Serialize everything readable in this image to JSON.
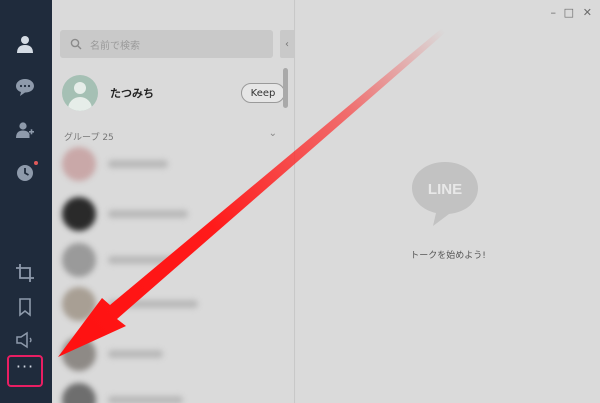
{
  "sidebar": {
    "icons": [
      "profile-icon",
      "chat-icon",
      "add-friend-icon",
      "timeline-icon",
      "crop-icon",
      "bookmark-icon",
      "announcement-icon",
      "more-icon"
    ],
    "more_label": "···"
  },
  "friends": {
    "search_placeholder": "名前で検索",
    "profile_name": "たつみち",
    "keep_label": "Keep",
    "group_header": "グループ 25"
  },
  "chat": {
    "logo_text": "LINE",
    "empty_message": "トークを始めよう!",
    "window_controls": [
      "–",
      "□",
      "✕"
    ]
  },
  "colors": {
    "sidebar_bg": "#1f2b3c",
    "panel_bg": "#dadada",
    "highlight_border": "#e91e63",
    "arrow": "#ff1a1a"
  }
}
